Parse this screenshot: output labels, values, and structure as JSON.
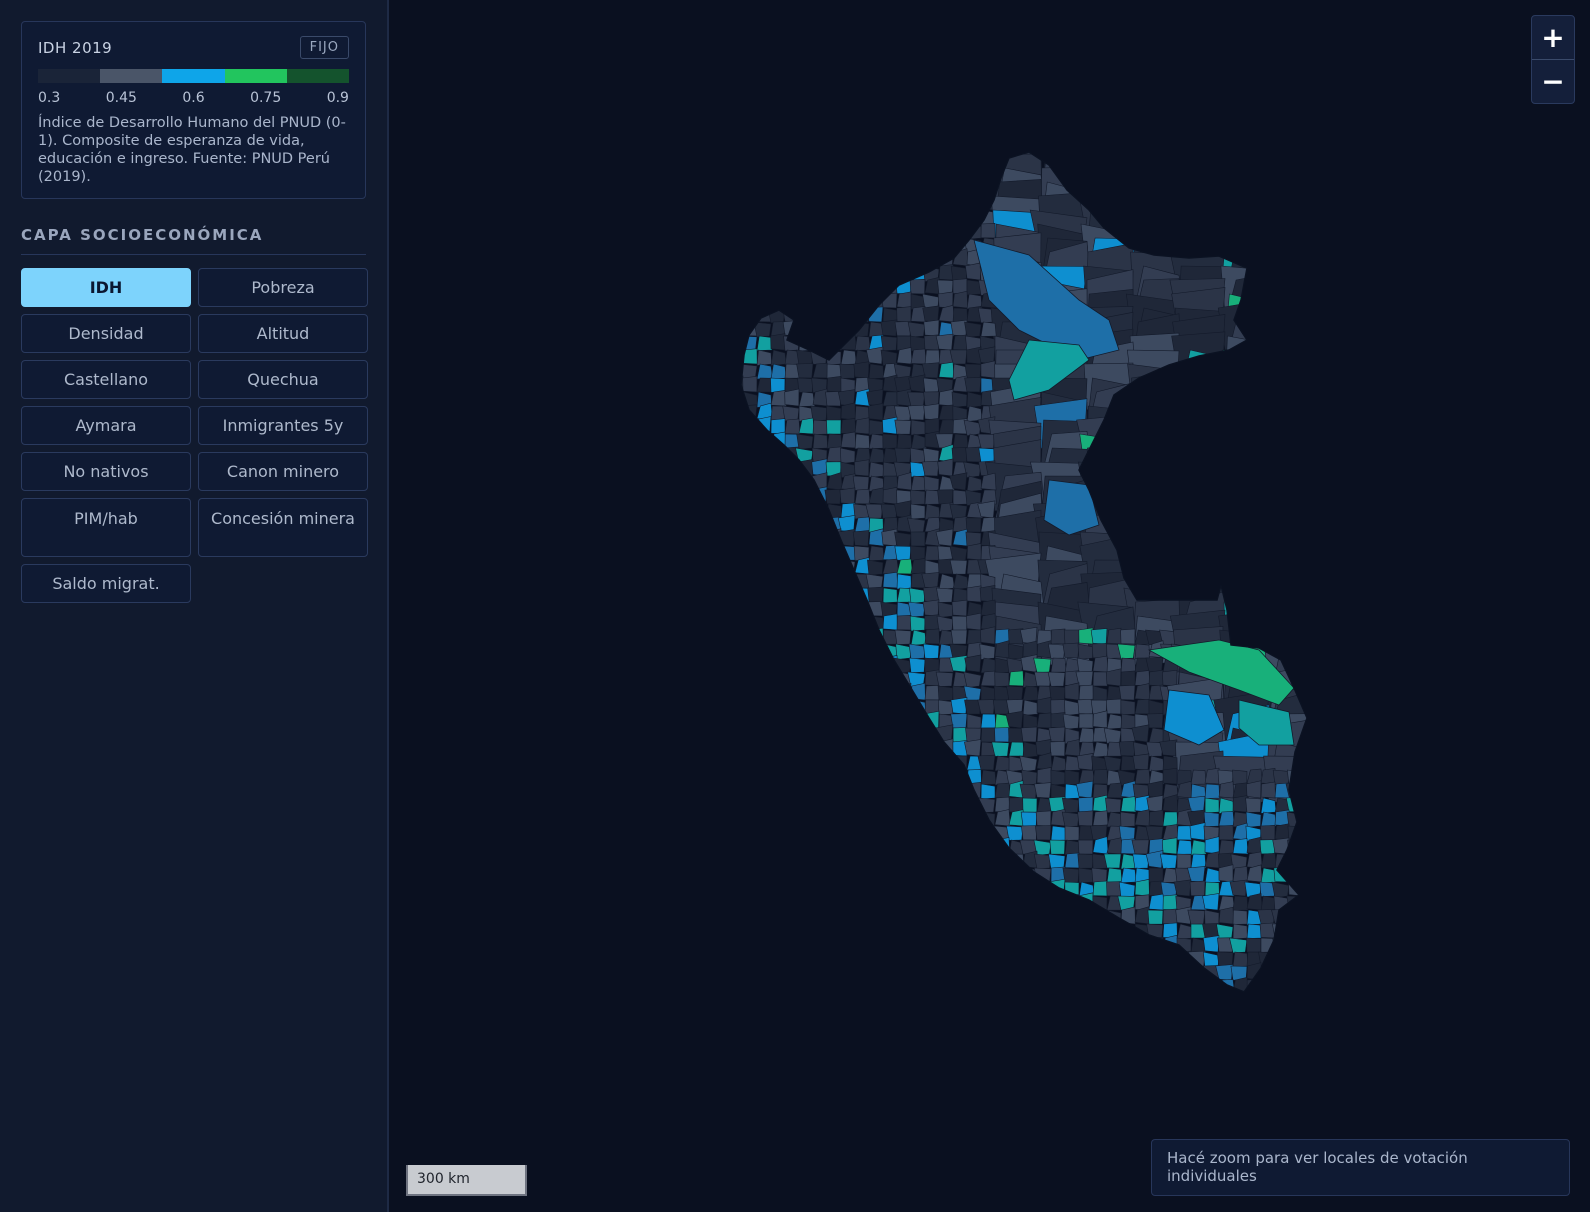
{
  "legend": {
    "title": "IDH 2019",
    "badge": "FIJO",
    "colors": [
      "#1a2438",
      "#4a5568",
      "#0ea5e9",
      "#22c55e",
      "#14532d"
    ],
    "ticks": [
      "0.3",
      "0.45",
      "0.6",
      "0.75",
      "0.9"
    ],
    "description": "Índice de Desarrollo Humano del PNUD (0-1). Composite de esperanza de vida, educación e ingreso. Fuente: PNUD Perú (2019)."
  },
  "layers": {
    "title": "CAPA SOCIOECONÓMICA",
    "active": "IDH",
    "buttons": [
      "IDH",
      "Pobreza",
      "Densidad",
      "Altitud",
      "Castellano",
      "Quechua",
      "Aymara",
      "Inmigrantes 5y",
      "No nativos",
      "Canon minero",
      "PIM/hab",
      "Concesión minera",
      "Saldo migrat."
    ]
  },
  "map": {
    "zoom_in": "+",
    "zoom_out": "−",
    "scale_label": "300 km",
    "hint": "Hacé zoom para ver locales de votación individuales",
    "region_palette": [
      "#232c3e",
      "#2b3447",
      "#333d52",
      "#3d4a60",
      "#1f2738",
      "#1e6fa8",
      "#0e8fd0",
      "#12a0a0",
      "#18b07a"
    ]
  }
}
